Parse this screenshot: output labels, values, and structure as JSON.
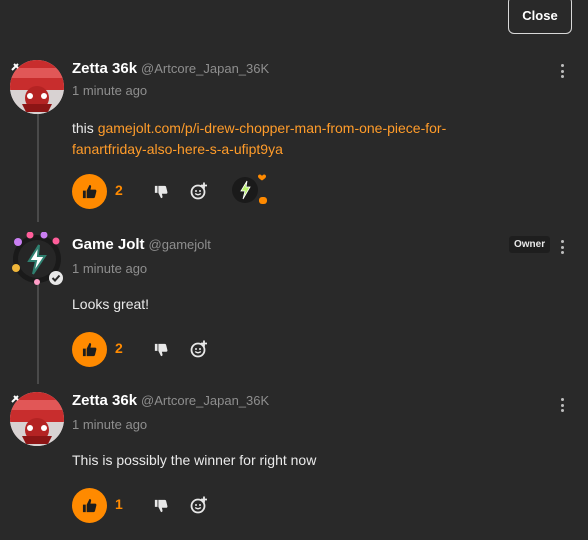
{
  "header": {
    "close_label": "Close"
  },
  "comments": [
    {
      "author": "Zetta 36k",
      "handle": "@Artcore_Japan_36K",
      "time": "1 minute ago",
      "body_prefix": "this ",
      "link_line1": "gamejolt.com/p/i-drew-chopper-man-from-one-piece-for-",
      "link_line2": "fanartfriday-also-here-s-a-ufipt9ya",
      "likes": "2",
      "avatar_icon": "zetta-avatar"
    },
    {
      "author": "Game Jolt",
      "handle": "@gamejolt",
      "time": "1 minute ago",
      "badge": "Owner",
      "body": "Looks great!",
      "likes": "2",
      "avatar_icon": "gamejolt-avatar"
    },
    {
      "author": "Zetta 36k",
      "handle": "@Artcore_Japan_36K",
      "time": "1 minute ago",
      "body": "This is possibly the winner for right now",
      "likes": "1",
      "avatar_icon": "zetta-avatar"
    }
  ],
  "colors": {
    "background": "#292929",
    "accent": "#ff8a00",
    "link": "#ff9c2a",
    "muted": "#8e8e8e"
  },
  "icons": [
    "close-button",
    "more-vertical-icon",
    "thumbs-up-icon",
    "thumbs-down-icon",
    "add-reaction-icon",
    "lightning-reaction-icon",
    "verified-check-icon"
  ]
}
